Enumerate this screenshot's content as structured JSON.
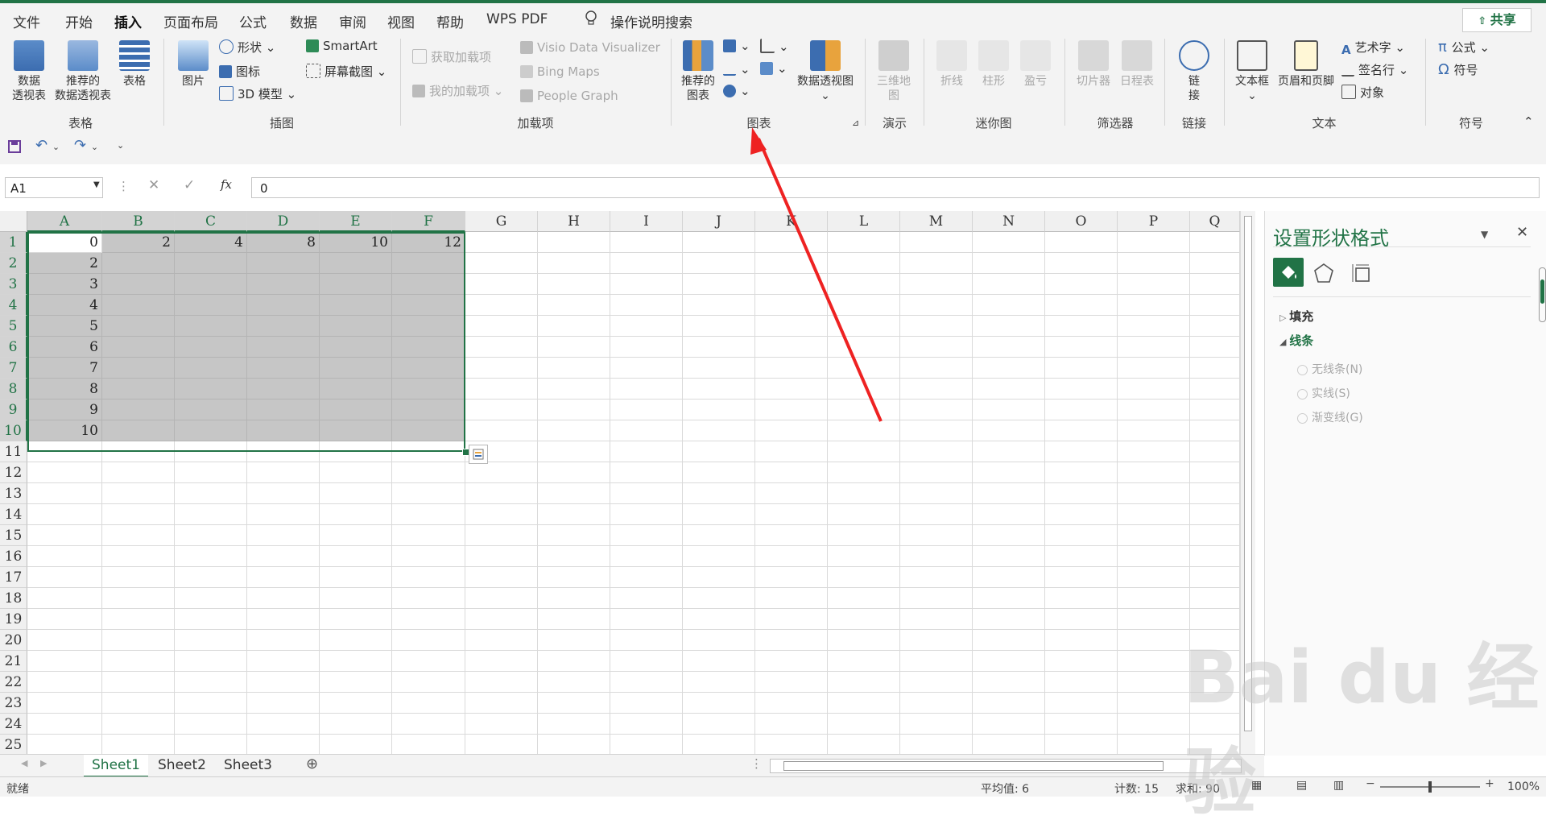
{
  "tabs": [
    "文件",
    "开始",
    "插入",
    "页面布局",
    "公式",
    "数据",
    "审阅",
    "视图",
    "帮助",
    "WPS PDF"
  ],
  "active_tab": "插入",
  "tell_me": "操作说明搜索",
  "share": "共享",
  "ribbon": {
    "tables": {
      "label": "表格",
      "pivot": "数据\n透视表",
      "recommended_pivot": "推荐的\n数据透视表",
      "table": "表格"
    },
    "illustrations": {
      "label": "插图",
      "pictures": "图片",
      "shapes": "形状",
      "icons": "图标",
      "model3d": "3D 模型",
      "smartart": "SmartArt",
      "screenshot": "屏幕截图"
    },
    "addins": {
      "label": "加载项",
      "get": "获取加载项",
      "my": "我的加载项",
      "visio": "Visio Data Visualizer",
      "bing": "Bing Maps",
      "people": "People Graph"
    },
    "charts": {
      "label": "图表",
      "recommended": "推荐的\n图表",
      "pivotchart": "数据透视图"
    },
    "tours": {
      "label": "演示",
      "map3d": "三维地\n图"
    },
    "sparklines": {
      "label": "迷你图",
      "line": "折线",
      "column": "柱形",
      "winloss": "盈亏"
    },
    "filters": {
      "label": "筛选器",
      "slicer": "切片器",
      "timeline": "日程表"
    },
    "links": {
      "label": "链接",
      "link": "链\n接"
    },
    "text": {
      "label": "文本",
      "textbox": "文本框",
      "header": "页眉和页脚",
      "wordart": "艺术字",
      "signature": "签名行",
      "object": "对象"
    },
    "symbols": {
      "label": "符号",
      "equation": "公式",
      "symbol": "符号"
    }
  },
  "formula_bar": {
    "name_box": "A1",
    "value": "0",
    "fx": "fx"
  },
  "columns": [
    "A",
    "B",
    "C",
    "D",
    "E",
    "F",
    "G",
    "H",
    "I",
    "J",
    "K",
    "L",
    "M",
    "N",
    "O",
    "P",
    "Q"
  ],
  "rows": [
    "1",
    "2",
    "3",
    "4",
    "5",
    "6",
    "7",
    "8",
    "9",
    "10",
    "11",
    "12",
    "13",
    "14",
    "15",
    "16",
    "17",
    "18",
    "19",
    "20",
    "21",
    "22",
    "23",
    "24",
    "25"
  ],
  "cells": {
    "row1": [
      "0",
      "2",
      "4",
      "8",
      "10",
      "12"
    ],
    "colA": [
      "2",
      "3",
      "4",
      "5",
      "6",
      "7",
      "8",
      "9",
      "10"
    ]
  },
  "pane": {
    "title": "设置形状格式",
    "fill": "填充",
    "line": "线条",
    "options": [
      "无线条(N)",
      "实线(S)",
      "渐变线(G)"
    ]
  },
  "sheets": [
    "Sheet1",
    "Sheet2",
    "Sheet3"
  ],
  "status": {
    "ready": "就绪",
    "avg": "平均值: 6",
    "count": "计数: 15",
    "sum": "求和: 90",
    "zoom": "100%"
  },
  "watermark": "Bai du 经验",
  "colors": {
    "accent": "#217346",
    "arrow": "#ee2222"
  }
}
